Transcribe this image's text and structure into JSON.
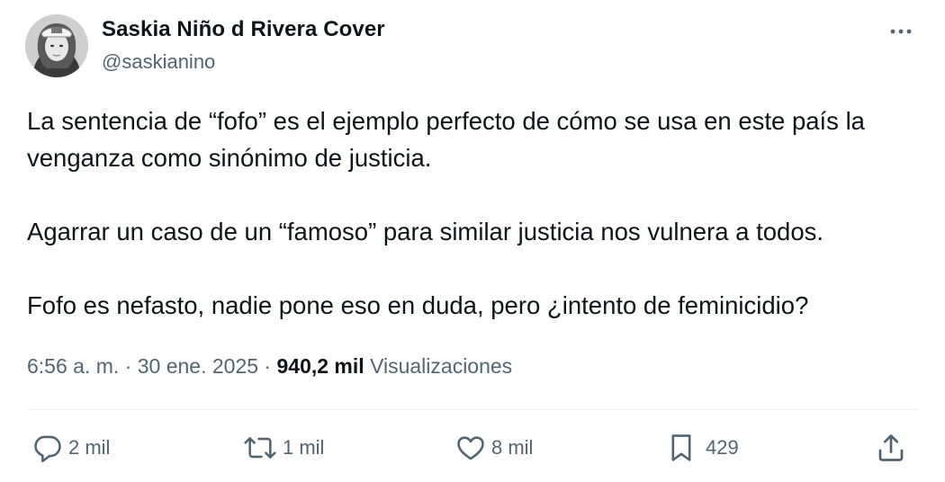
{
  "author": {
    "display_name": "Saskia Niño d Rivera Cover",
    "handle": "@saskianino",
    "avatar": "profile-photo"
  },
  "more_icon": "ellipsis-icon",
  "tweet": {
    "paragraphs": [
      "La sentencia de “fofo” es el ejemplo perfecto de cómo se usa en este país la venganza como sinónimo de justicia.",
      "Agarrar un caso de un “famoso” para similar justicia nos vulnera a todos.",
      "Fofo es nefasto, nadie pone eso en duda, pero ¿intento de feminicidio?"
    ]
  },
  "meta": {
    "time": "6:56 a. m.",
    "separator": "·",
    "date": "30 ene. 2025",
    "views_count": "940,2 mil",
    "views_label": "Visualizaciones"
  },
  "actions": {
    "reply": {
      "icon": "reply-icon",
      "count": "2 mil"
    },
    "retweet": {
      "icon": "retweet-icon",
      "count": "1 mil"
    },
    "like": {
      "icon": "heart-icon",
      "count": "8 mil"
    },
    "bookmark": {
      "icon": "bookmark-icon",
      "count": "429"
    },
    "share": {
      "icon": "share-icon"
    }
  },
  "colors": {
    "text": "#0f1419",
    "secondary": "#536471",
    "divider": "#eff3f4",
    "background": "#ffffff"
  }
}
